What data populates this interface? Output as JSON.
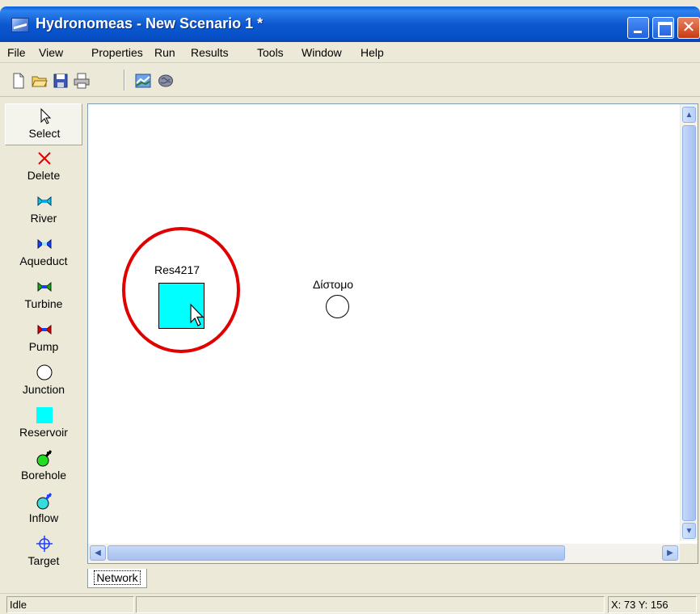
{
  "window": {
    "title": "Hydronomeas - New Scenario 1 *",
    "buttons": {
      "minimize": "",
      "maximize": "",
      "close": "✕"
    }
  },
  "menu": [
    "File",
    "View",
    "Properties",
    "Run",
    "Results",
    "Tools",
    "Window",
    "Help"
  ],
  "toolbar": {
    "icons": [
      "new-icon",
      "open-folder-icon",
      "save-icon",
      "print-icon",
      "network-map-icon",
      "brain-icon"
    ]
  },
  "palette": {
    "selected": "Select",
    "items": [
      {
        "label": "Select",
        "icon": "cursor-icon"
      },
      {
        "label": "Delete",
        "icon": "delete-x-icon"
      },
      {
        "label": "River",
        "icon": "river-icon"
      },
      {
        "label": "Aqueduct",
        "icon": "aqueduct-icon"
      },
      {
        "label": "Turbine",
        "icon": "turbine-icon"
      },
      {
        "label": "Pump",
        "icon": "pump-icon"
      },
      {
        "label": "Junction",
        "icon": "junction-icon"
      },
      {
        "label": "Reservoir",
        "icon": "reservoir-icon"
      },
      {
        "label": "Borehole",
        "icon": "borehole-icon"
      },
      {
        "label": "Inflow",
        "icon": "inflow-icon"
      },
      {
        "label": "Target",
        "icon": "target-icon"
      }
    ]
  },
  "canvas": {
    "reservoir_label": "Res4217",
    "junction_label": "Δίστομο"
  },
  "tabs": [
    "Network"
  ],
  "status": {
    "message": "Idle",
    "coords": "X: 73 Y: 156"
  },
  "colors": {
    "reservoir": "#00ffff",
    "highlight": "#e00000",
    "titlebar": "#0d58d0"
  }
}
